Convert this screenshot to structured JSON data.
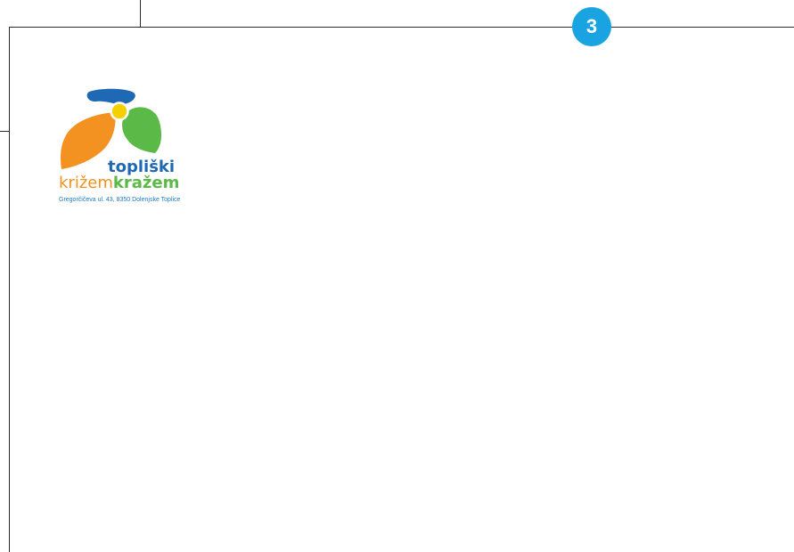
{
  "page_number": "3",
  "colors": {
    "badge": "#19a4e1",
    "brand_blue": "#1e68b4",
    "brand_orange": "#f39220",
    "brand_green": "#5ab947",
    "brand_yellow": "#f5d000"
  },
  "logo": {
    "line1": "topliški",
    "line2_part1": "križem",
    "line2_part2": "kražem",
    "address": "Gregorčičeva ul. 43, 8350 Dolenjske Toplice"
  }
}
